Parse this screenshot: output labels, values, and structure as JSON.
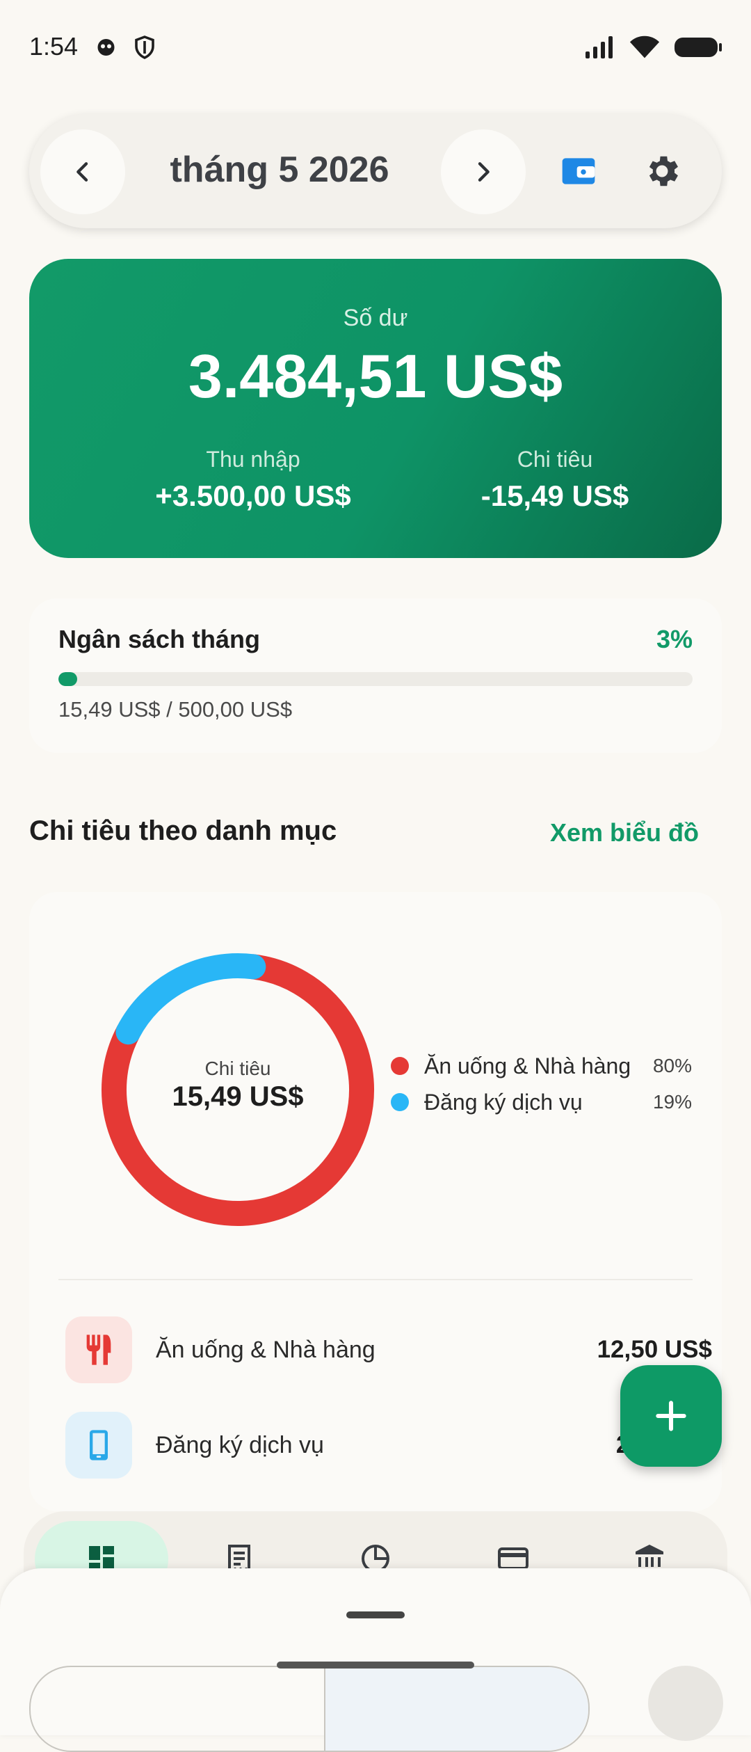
{
  "status": {
    "time": "1:54"
  },
  "header": {
    "month_title": "tháng 5 2026"
  },
  "balance": {
    "label": "Số dư",
    "value": "3.484,51 US$",
    "income_label": "Thu nhập",
    "income_value": "+3.500,00 US$",
    "expense_label": "Chi tiêu",
    "expense_value": "-15,49 US$"
  },
  "budget": {
    "title": "Ngân sách tháng",
    "percent_text": "3%",
    "progress_fraction": 0.03,
    "amount_text": "15,49 US$ / 500,00 US$"
  },
  "categories_section": {
    "title": "Chi tiêu theo danh mục",
    "link": "Xem biểu đồ",
    "donut": {
      "center_label": "Chi tiêu",
      "center_value": "15,49 US$",
      "slices": [
        {
          "name": "Ăn uống & Nhà hàng",
          "percent_text": "80%",
          "share": 0.807,
          "color": "#E53935"
        },
        {
          "name": "Đăng ký dịch vụ",
          "percent_text": "19%",
          "share": 0.193,
          "color": "#29B6F6"
        }
      ]
    },
    "rows": [
      {
        "name": "Ăn uống & Nhà hàng",
        "amount": "12,50 US$",
        "icon": "restaurant-icon",
        "icon_color": "#E53935",
        "icon_bg": "#FBE4E1"
      },
      {
        "name": "Đăng ký dịch vụ",
        "amount": "2,99",
        "icon": "phone-icon",
        "icon_color": "#29A8E8",
        "icon_bg": "#E1F1FA"
      }
    ]
  },
  "colors": {
    "accent": "#119A68",
    "balance_card": "#0E9366",
    "fab": "#0E9A66"
  },
  "nav": {
    "items": [
      "dashboard-icon",
      "receipt-icon",
      "pie-chart-icon",
      "card-icon",
      "bank-icon"
    ]
  }
}
